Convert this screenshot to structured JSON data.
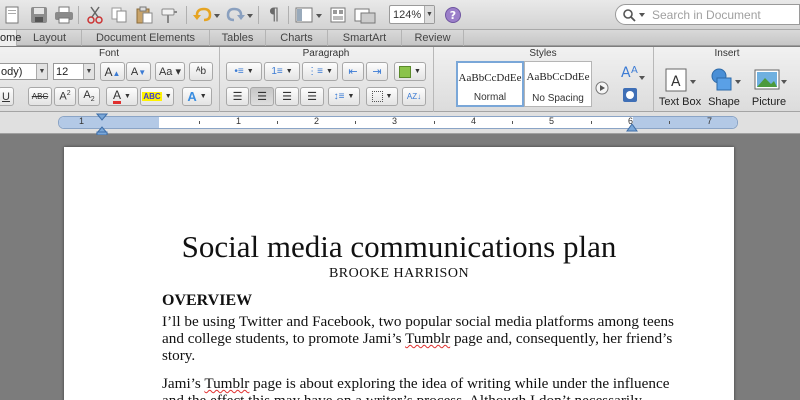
{
  "toolbar": {
    "zoom": "124%",
    "search_placeholder": "Search in Document"
  },
  "tabs": [
    "ome",
    "Layout",
    "Document Elements",
    "Tables",
    "Charts",
    "SmartArt",
    "Review"
  ],
  "ribbon": {
    "groups": {
      "font": "Font",
      "paragraph": "Paragraph",
      "styles": "Styles",
      "insert": "Insert"
    },
    "font_name": "ody)",
    "font_size": "12",
    "styles": [
      {
        "sample": "AaBbCcDdEe",
        "name": "Normal"
      },
      {
        "sample": "AaBbCcDdEe",
        "name": "No Spacing"
      }
    ],
    "insert": [
      "Text Box",
      "Shape",
      "Picture"
    ]
  },
  "ruler": {
    "numbers": [
      "1",
      "1",
      "2",
      "3",
      "4",
      "5",
      "6",
      "7"
    ]
  },
  "document": {
    "title": "Social media communications plan",
    "author": "BROOKE HARRISON",
    "heading": "OVERVIEW",
    "para1": [
      "I’ll be using Twitter and Facebook, two popular social media platforms among teens",
      "and college students, to promote Jami’s ",
      "Tumblr",
      " page and, consequently, her friend’s",
      "story."
    ],
    "para2": [
      "Jami’s ",
      "Tumblr",
      " page is about exploring the idea of writing while under the influence",
      "and the effect this may have on a writer’s process. Although I don’t necessarily"
    ]
  },
  "colors": {
    "accent": "#3b7bd4",
    "font_color_red": "#e0302f",
    "highlight_yellow": "#fff200"
  }
}
